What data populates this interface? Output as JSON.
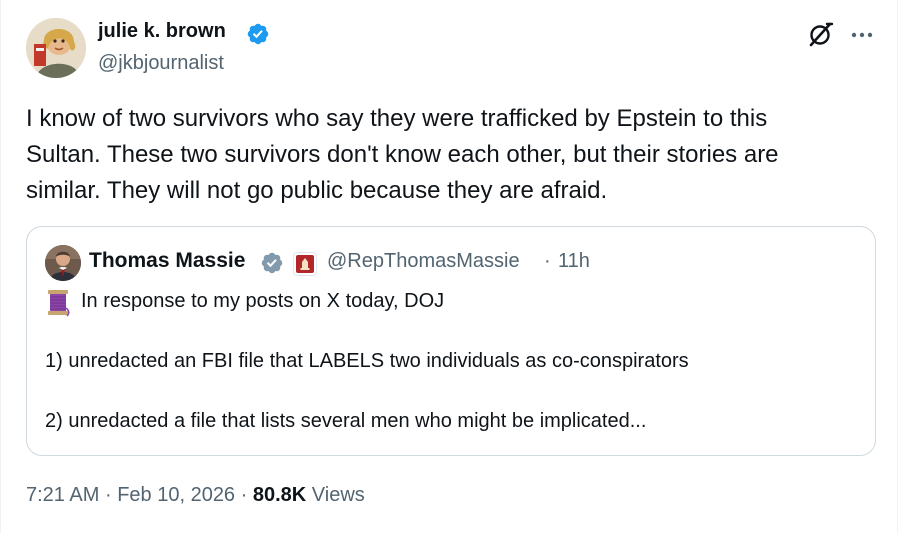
{
  "author": {
    "display_name": "julie k. brown",
    "handle": "@jkbjournalist",
    "verified": true
  },
  "icons": {
    "verified_badge": "verified-badge-blue",
    "verified_badge_gov": "verified-badge-grey",
    "grok": "grok-icon",
    "more": "more-icon",
    "affiliate": "us-house-seal-badge",
    "spool": "thread-spool-emoji"
  },
  "tweet": {
    "text": "I know of two survivors who say they were trafficked by Epstein to this\nSultan. These two survivors don't know each other, but their stories are\nsimilar. They will not go public because they are afraid."
  },
  "quoted_tweet": {
    "display_name": "Thomas Massie",
    "handle": "@RepThomasMassie",
    "separator": "·",
    "time": "11h",
    "line1": "In response to my posts on X today, DOJ",
    "line2": "1) unredacted an FBI file that LABELS two individuals as co-conspirators",
    "line3": "2) unredacted a file that lists several men who might be implicated..."
  },
  "meta": {
    "time": "7:21 AM",
    "sep1": "·",
    "date": "Feb 10, 2026",
    "sep2": "·",
    "views_count": "80.8K",
    "views_label": "Views"
  },
  "colors": {
    "text_primary": "#0f1419",
    "text_secondary": "#536471",
    "verified_blue": "#1d9bf0",
    "verified_grey": "#829aab",
    "border": "#cfd9de"
  }
}
